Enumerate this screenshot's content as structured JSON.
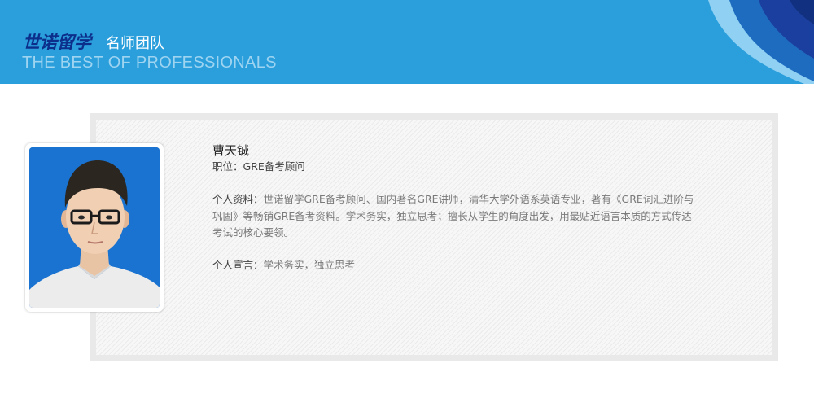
{
  "header": {
    "brand": "世诺留学",
    "section_title": "名师团队",
    "subtitle": "THE BEST OF PROFESSIONALS",
    "colors": {
      "banner": "#2a9fdc",
      "brand": "#0d2f8c",
      "ribbon_dark": "#1b3f9e",
      "ribbon_mid": "#1e6cc0"
    }
  },
  "teacher": {
    "name": "曹天铖",
    "position_label": "职位：",
    "position_value": "GRE备考顾问",
    "profile_label": "个人资料：",
    "profile_lines": [
      "世诺留学GRE备考顾问、国内著名GRE讲师，清华大学外语系英语专业，著有《GRE词汇进阶与",
      "巩固》等畅销GRE备考资料。学术务实，独立思考；擅长从学生的角度出发，用最贴近语言本质的方式传达",
      "考试的核心要领。"
    ],
    "motto_label": "个人宣言：",
    "motto_value": "学术务实，独立思考",
    "photo_icon": "portrait-photo"
  }
}
